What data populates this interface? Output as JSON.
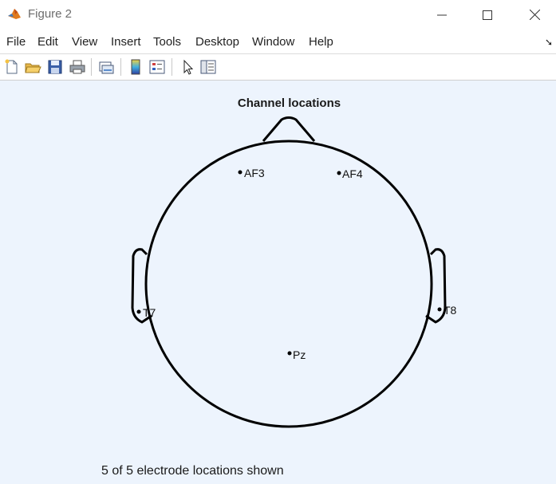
{
  "window": {
    "title": "Figure 2"
  },
  "menu": {
    "items": [
      {
        "label": "File"
      },
      {
        "label": "Edit"
      },
      {
        "label": "View"
      },
      {
        "label": "Insert"
      },
      {
        "label": "Tools"
      },
      {
        "label": "Desktop"
      },
      {
        "label": "Window"
      },
      {
        "label": "Help"
      }
    ]
  },
  "toolbar": {
    "buttons": [
      "new-figure-icon",
      "open-file-icon",
      "save-icon",
      "print-icon",
      "link-plot-icon",
      "colorbar-icon",
      "legend-icon",
      "edit-plot-pointer-icon",
      "property-inspector-icon"
    ]
  },
  "figure": {
    "title": "Channel locations",
    "footer": "5 of 5 electrode locations shown",
    "electrodes": [
      {
        "label": "AF3"
      },
      {
        "label": "AF4"
      },
      {
        "label": "T7"
      },
      {
        "label": "T8"
      },
      {
        "label": "Pz"
      }
    ]
  },
  "colors": {
    "figure_background": "#edf4fd",
    "matlab_orange": "#e07b1f"
  }
}
